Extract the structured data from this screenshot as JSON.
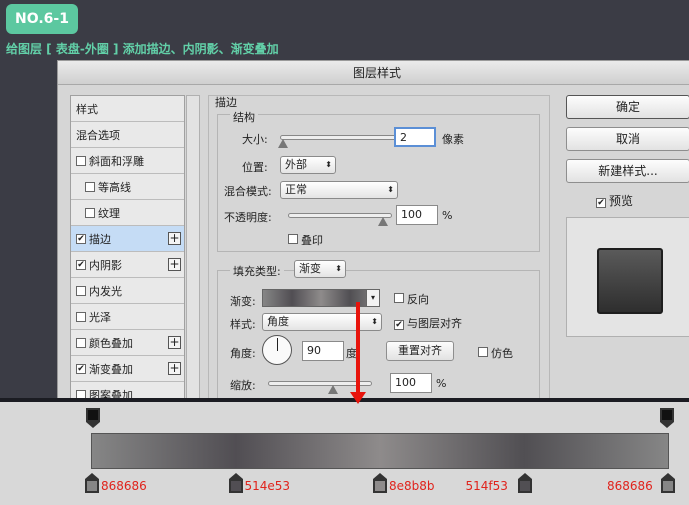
{
  "header": {
    "tag": "NO.6-1",
    "subtitle": "给图层 [ 表盘-外圈 ] 添加描边、内阴影、渐变叠加"
  },
  "dialog": {
    "title": "图层样式"
  },
  "styles": [
    {
      "label": "样式",
      "checkbox": false,
      "plus": false,
      "selected": false,
      "checked": false
    },
    {
      "label": "混合选项",
      "checkbox": false,
      "plus": false,
      "selected": false,
      "checked": false
    },
    {
      "label": "斜面和浮雕",
      "checkbox": true,
      "plus": false,
      "selected": false,
      "checked": false
    },
    {
      "label": "等高线",
      "checkbox": true,
      "plus": false,
      "selected": false,
      "checked": false,
      "indent": true
    },
    {
      "label": "纹理",
      "checkbox": true,
      "plus": false,
      "selected": false,
      "checked": false,
      "indent": true
    },
    {
      "label": "描边",
      "checkbox": true,
      "plus": true,
      "selected": true,
      "checked": true
    },
    {
      "label": "内阴影",
      "checkbox": true,
      "plus": true,
      "selected": false,
      "checked": true
    },
    {
      "label": "内发光",
      "checkbox": true,
      "plus": false,
      "selected": false,
      "checked": false
    },
    {
      "label": "光泽",
      "checkbox": true,
      "plus": false,
      "selected": false,
      "checked": false
    },
    {
      "label": "颜色叠加",
      "checkbox": true,
      "plus": true,
      "selected": false,
      "checked": false
    },
    {
      "label": "渐变叠加",
      "checkbox": true,
      "plus": true,
      "selected": false,
      "checked": true
    },
    {
      "label": "图案叠加",
      "checkbox": true,
      "plus": false,
      "selected": false,
      "checked": false
    }
  ],
  "stroke": {
    "title": "描边",
    "structure": "结构",
    "size_label": "大小:",
    "size_value": "2",
    "size_unit": "像素",
    "position_label": "位置:",
    "position_value": "外部",
    "blend_label": "混合模式:",
    "blend_value": "正常",
    "opacity_label": "不透明度:",
    "opacity_value": "100",
    "opacity_unit": "%",
    "overprint": "叠印",
    "fill_type_label": "填充类型:",
    "fill_type_value": "渐变",
    "gradient_label": "渐变:",
    "reverse": "反向",
    "style_label": "样式:",
    "style_value": "角度",
    "align": "与图层对齐",
    "angle_label": "角度:",
    "angle_value": "90",
    "angle_unit": "度",
    "reset": "重置对齐",
    "dither": "仿色",
    "scale_label": "缩放:",
    "scale_value": "100",
    "scale_unit": "%"
  },
  "buttons": {
    "ok": "确定",
    "cancel": "取消",
    "new_style": "新建样式...",
    "preview": "预览"
  },
  "gradient_stops": [
    {
      "color": "#868686",
      "label": "868686"
    },
    {
      "color": "#514e53",
      "label": "514e53"
    },
    {
      "color": "#8e8b8b",
      "label": "8e8b8b"
    },
    {
      "color": "#514f53",
      "label": "514f53"
    },
    {
      "color": "#868686",
      "label": "868686"
    }
  ]
}
